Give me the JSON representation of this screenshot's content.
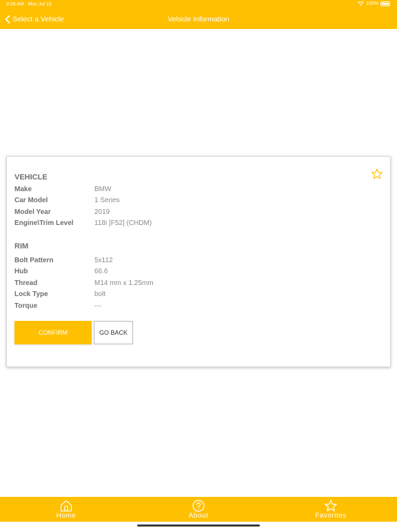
{
  "status": {
    "time": "9:26 AM",
    "date": "Mon Jul 19",
    "battery": "100%"
  },
  "nav": {
    "back_label": "Select a Vehicle",
    "title": "Vehicle Information"
  },
  "vehicle": {
    "title": "VEHICLE",
    "rows": [
      {
        "label": "Make",
        "value": "BMW"
      },
      {
        "label": "Car Model",
        "value": "1 Series"
      },
      {
        "label": "Model Year",
        "value": "2019"
      },
      {
        "label": "Engine\\Trim Level",
        "value": "118i [F52] (CHDM)"
      }
    ]
  },
  "rim": {
    "title": "RIM",
    "rows": [
      {
        "label": "Bolt Pattern",
        "value": "5x112"
      },
      {
        "label": "Hub",
        "value": "66.6"
      },
      {
        "label": "Thread",
        "value": "M14 mm x  1.25mm"
      },
      {
        "label": "Lock Type",
        "value": "bolt"
      },
      {
        "label": "Torque",
        "value": "---"
      }
    ]
  },
  "buttons": {
    "confirm": "CONFIRM",
    "go_back": "GO BACK"
  },
  "tabs": [
    {
      "label": "Home",
      "icon": "home-icon"
    },
    {
      "label": "About",
      "icon": "question-circle-icon"
    },
    {
      "label": "Favorites",
      "icon": "star-icon"
    }
  ],
  "colors": {
    "accent": "#FFC001",
    "label": "#6f6f6f",
    "value": "#8a8a8a"
  }
}
